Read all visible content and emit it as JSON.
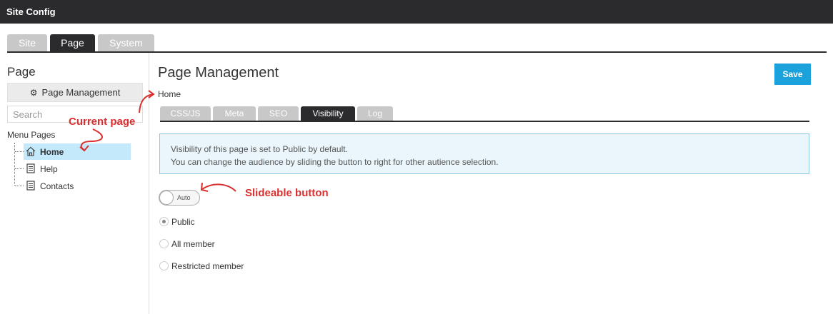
{
  "app": {
    "title": "Site Config"
  },
  "main_tabs": [
    {
      "label": "Site"
    },
    {
      "label": "Page"
    },
    {
      "label": "System"
    }
  ],
  "sidebar": {
    "title": "Page",
    "page_management_label": "Page Management",
    "search_placeholder": "Search",
    "menu_label": "Menu Pages",
    "items": [
      {
        "label": "Home",
        "icon": "home-icon"
      },
      {
        "label": "Help",
        "icon": "document-icon"
      },
      {
        "label": "Contacts",
        "icon": "document-icon"
      }
    ]
  },
  "content": {
    "title": "Page Management",
    "save_label": "Save",
    "breadcrumb": "Home",
    "tabs": [
      {
        "label": "CSS/JS"
      },
      {
        "label": "Meta"
      },
      {
        "label": "SEO"
      },
      {
        "label": "Visibility"
      },
      {
        "label": "Log"
      }
    ],
    "info_line1": "Visibility of this page is set to Public by default.",
    "info_line2": "You can change the audience by sliding the button to right for other autience selection.",
    "toggle_label": "Auto",
    "radios": [
      {
        "label": "Public",
        "checked": true
      },
      {
        "label": "All member",
        "checked": false
      },
      {
        "label": "Restricted member",
        "checked": false
      }
    ]
  },
  "annotations": {
    "current_page": "Current page",
    "slideable_button": "Slideable button"
  },
  "colors": {
    "topbar": "#2b2b2d",
    "active_tab": "#2b2b2d",
    "inactive_tab": "#c8c8c8",
    "save_button": "#1ba2dc",
    "selected_item": "#c3e9fb",
    "info_bg": "#eaf6fb",
    "annotation": "#d92f2f"
  }
}
